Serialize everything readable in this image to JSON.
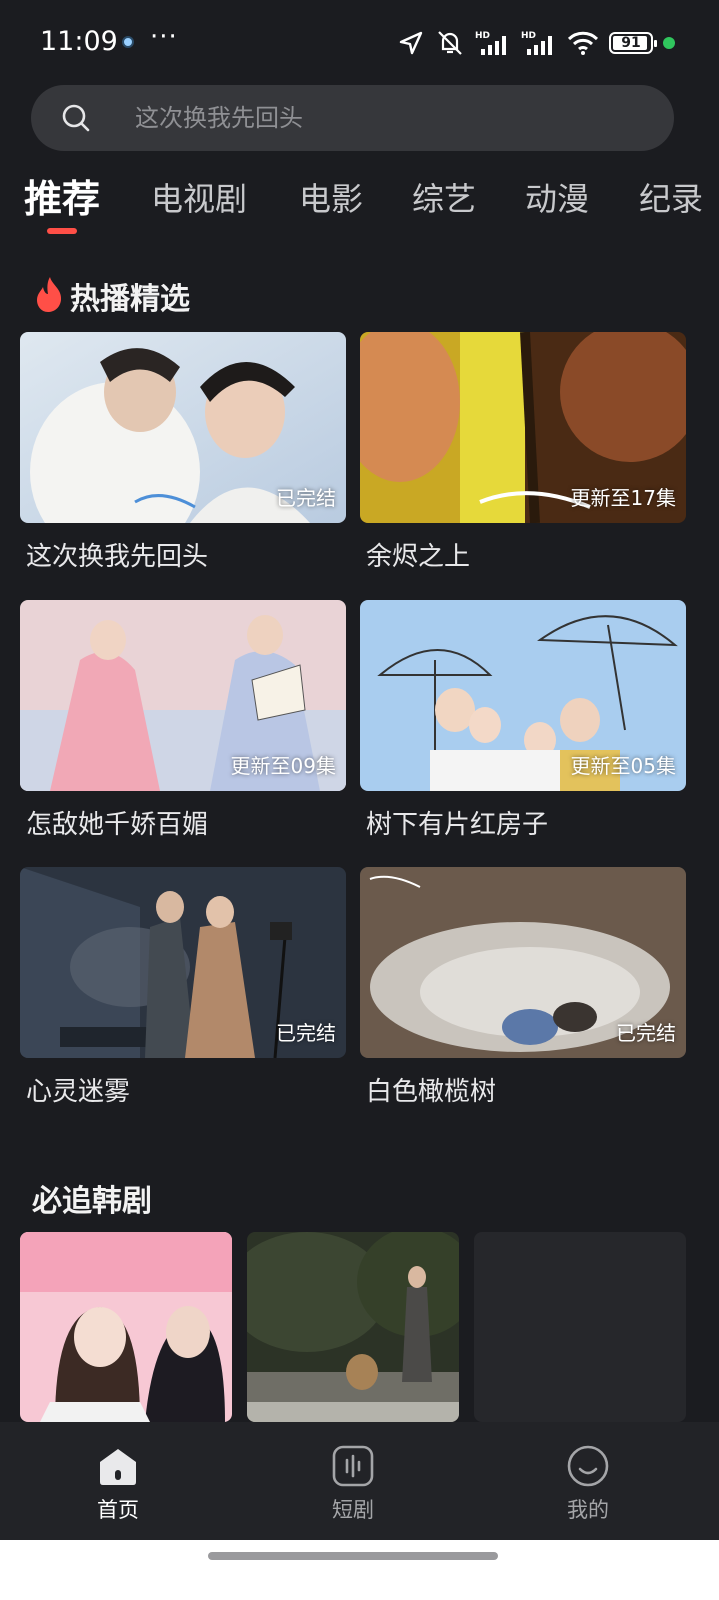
{
  "status_bar": {
    "time": "11:09",
    "more": "···",
    "battery": "91",
    "icons": [
      "location-arrow-icon",
      "mute-bell-icon",
      "signal-hd-icon",
      "signal-hd-icon",
      "wifi-icon",
      "battery-icon"
    ]
  },
  "search": {
    "placeholder": "这次换我先回头"
  },
  "tabs": [
    {
      "label": "推荐",
      "active": true
    },
    {
      "label": "电视剧"
    },
    {
      "label": "电影"
    },
    {
      "label": "综艺"
    },
    {
      "label": "动漫"
    },
    {
      "label": "纪录"
    }
  ],
  "hot_section": {
    "title": "热播精选",
    "items": [
      {
        "title": "这次换我先回头",
        "badge": "已完结"
      },
      {
        "title": "余烬之上",
        "badge": "更新至17集"
      },
      {
        "title": "怎敌她千娇百媚",
        "badge": "更新至09集"
      },
      {
        "title": "树下有片红房子",
        "badge": "更新至05集"
      },
      {
        "title": "心灵迷雾",
        "badge": "已完结"
      },
      {
        "title": "白色橄榄树",
        "badge": "已完结"
      }
    ]
  },
  "korean_section": {
    "title": "必追韩剧"
  },
  "bottom_nav": [
    {
      "label": "首页",
      "icon": "home-icon",
      "active": true
    },
    {
      "label": "短剧",
      "icon": "short-drama-icon"
    },
    {
      "label": "我的",
      "icon": "profile-icon"
    }
  ],
  "colors": {
    "accent": "#ff4f47",
    "background": "#1b1c20",
    "nav_bg": "#222327"
  }
}
